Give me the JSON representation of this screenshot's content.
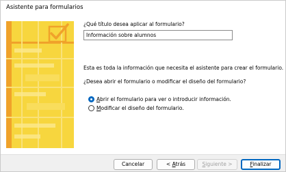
{
  "window": {
    "title": "Asistente para formularios"
  },
  "form": {
    "title_question": "¿Qué título desea aplicar al formulario?",
    "title_value": "Información sobre alumnos",
    "info_text": "Esta es toda la información que necesita el asistente para crear el formulario.",
    "open_question": "¿Desea abrir el formulario o modificar el diseño del formulario?",
    "options": [
      {
        "mnemonic": "A",
        "rest": "brir el formulario para ver o introducir información.",
        "selected": true
      },
      {
        "mnemonic": "M",
        "rest": "odificar el diseño del formulario.",
        "selected": false
      }
    ]
  },
  "buttons": {
    "cancel": "Cancelar",
    "back_prefix": "< ",
    "back_mnemonic": "A",
    "back_rest": "trás",
    "next_prefix": "",
    "next_mnemonic": "S",
    "next_rest": "iguiente >",
    "finish_mnemonic": "F",
    "finish_rest": "inalizar"
  },
  "colors": {
    "banner_yellow": "#f7d63e",
    "banner_orange": "#f0a22a",
    "accent": "#0067c0"
  },
  "icons": {
    "banner": "form-checkmark-icon"
  }
}
